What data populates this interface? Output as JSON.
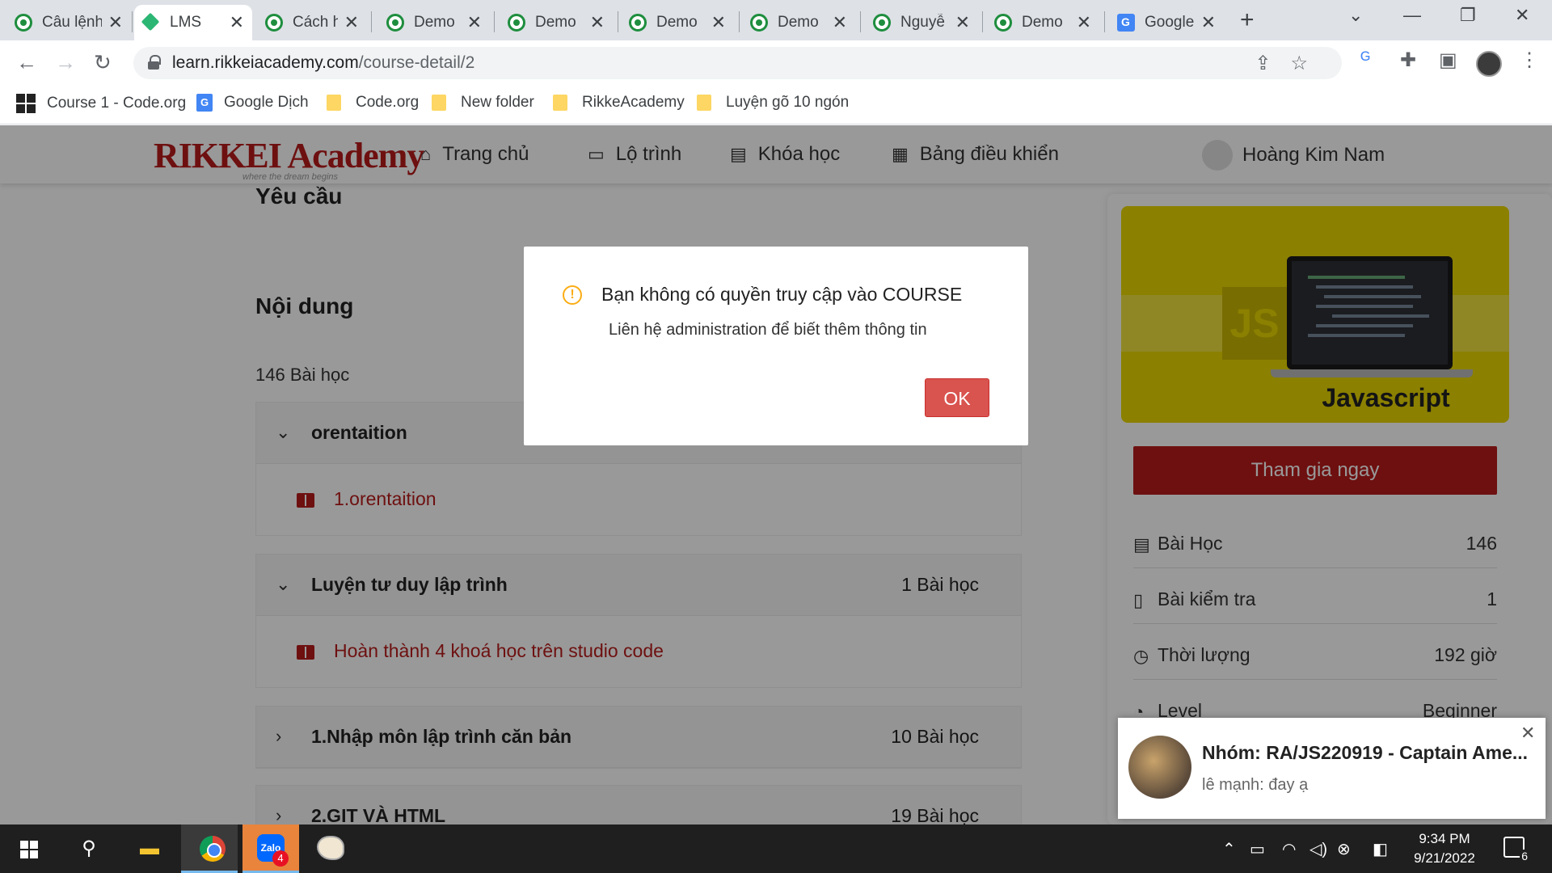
{
  "browser": {
    "tabs": [
      {
        "title": "Câu lệnh",
        "icon": "codesandbox-icon",
        "active": false
      },
      {
        "title": "LMS",
        "icon": "lms-icon",
        "active": true
      },
      {
        "title": "Cách h",
        "icon": "codesandbox-icon",
        "active": false
      },
      {
        "title": "Demo",
        "icon": "codesandbox-icon",
        "active": false
      },
      {
        "title": "Demo",
        "icon": "codesandbox-icon",
        "active": false
      },
      {
        "title": "Demo",
        "icon": "codesandbox-icon",
        "active": false
      },
      {
        "title": "Demo",
        "icon": "codesandbox-icon",
        "active": false
      },
      {
        "title": "Nguyễ",
        "icon": "codesandbox-icon",
        "active": false
      },
      {
        "title": "Demo",
        "icon": "codesandbox-icon",
        "active": false
      },
      {
        "title": "Google",
        "icon": "google-translate-icon",
        "active": false
      }
    ],
    "url_domain": "learn.rikkeiacademy.com",
    "url_path": "/course-detail/2",
    "bookmarks": [
      {
        "label": "Course 1 - Code.org",
        "icon": "codeorg-icon"
      },
      {
        "label": "Google Dịch",
        "icon": "google-translate-icon"
      },
      {
        "label": "Code.org",
        "icon": "folder-icon"
      },
      {
        "label": "New folder",
        "icon": "folder-icon"
      },
      {
        "label": "RikkeAcademy",
        "icon": "folder-icon"
      },
      {
        "label": "Luyện gõ 10 ngón",
        "icon": "folder-icon"
      }
    ]
  },
  "site": {
    "logo_text": "RIKKEI Academy",
    "logo_tagline": "where the dream begins",
    "nav": [
      {
        "label": "Trang chủ",
        "icon": "home-icon"
      },
      {
        "label": "Lộ trình",
        "icon": "roadmap-icon"
      },
      {
        "label": "Khóa học",
        "icon": "book-icon"
      },
      {
        "label": "Bảng điều khiển",
        "icon": "dashboard-icon"
      }
    ],
    "user_name": "Hoàng Kim Nam"
  },
  "main": {
    "requirements_heading": "Yêu cầu",
    "content_heading": "Nội dung",
    "lesson_count": "146 Bài học",
    "sections": [
      {
        "title": "orentaition",
        "count": "",
        "expanded": true,
        "lessons": [
          "1.orentaition"
        ]
      },
      {
        "title": "Luyện tư duy lập trình",
        "count": "1 Bài học",
        "expanded": true,
        "lessons": [
          "Hoàn thành 4 khoá học trên studio code"
        ]
      },
      {
        "title": "1.Nhập môn lập trình căn bản",
        "count": "10 Bài học",
        "expanded": false,
        "lessons": []
      },
      {
        "title": "2.GIT VÀ HTML",
        "count": "19 Bài học",
        "expanded": false,
        "lessons": []
      }
    ]
  },
  "sidebar": {
    "thumbnail_label": "Javascript",
    "thumbnail_badge": "JS",
    "join_button": "Tham gia ngay",
    "stats": [
      {
        "label": "Bài Học",
        "value": "146",
        "icon": "book-open-icon"
      },
      {
        "label": "Bài kiểm tra",
        "value": "1",
        "icon": "bookmark-icon"
      },
      {
        "label": "Thời lượng",
        "value": "192 giờ",
        "icon": "clock-icon"
      },
      {
        "label": "Level",
        "value": "Beginner",
        "icon": "gauge-icon"
      }
    ]
  },
  "modal": {
    "title": "Bạn không có quyền truy cập vào COURSE",
    "message": "Liên hệ administration để biết thêm thông tin",
    "ok_label": "OK",
    "icon": "warning-icon"
  },
  "toast": {
    "title": "Nhóm: RA/JS220919 - Captain Ame...",
    "message": "lê mạnh: đay ạ"
  },
  "taskbar": {
    "time": "9:34 PM",
    "date": "9/21/2022",
    "zalo_badge": "4",
    "notification_count": "6"
  },
  "colors": {
    "brand_red": "#b71c1c",
    "ok_button": "#d9534f",
    "warning": "#faad14",
    "thumbnail_yellow": "#e8d500"
  }
}
